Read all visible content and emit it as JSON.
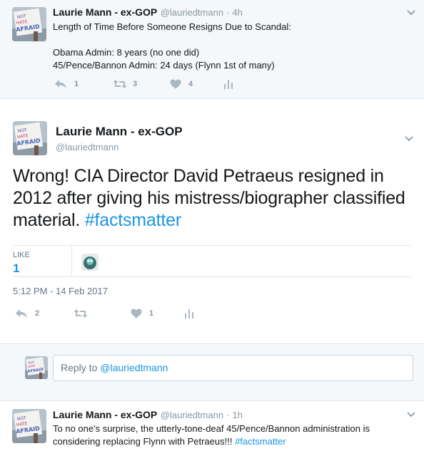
{
  "parent_tweet": {
    "name": "Laurie Mann - ex-GOP",
    "handle": "@lauriedtmann",
    "time": "· 4h",
    "lines": [
      "Length of Time Before Someone Resigns Due to Scandal:",
      "",
      "Obama Admin: 8 years (no one did)",
      "45/Pence/Bannon Admin: 24 days (Flynn 1st of many)"
    ],
    "reply_count": "1",
    "retweet_count": "3",
    "like_count": "4"
  },
  "main_tweet": {
    "name": "Laurie Mann - ex-GOP",
    "handle": "@lauriedtmann",
    "text": "Wrong! CIA Director David Petraeus resigned in 2012 after giving his mistress/biographer classified material.  ",
    "hashtag": "#factsmatter",
    "likes_label": "LIKE",
    "likes_count": "1",
    "timestamp": "5:12 PM - 14 Feb 2017",
    "reply_count": "2",
    "retweet_count": "",
    "like_count": "1"
  },
  "reply_box": {
    "prefix": "Reply to ",
    "mention": "@lauriedtmann"
  },
  "reply_tweet": {
    "name": "Laurie Mann - ex-GOP",
    "handle": "@lauriedtmann",
    "time": "· 1h",
    "text": "To no one's surprise, the utterly-tone-deaf 45/Pence/Bannon administration is considering replacing Flynn with Petraeus!!!  ",
    "hashtag": "#factsmatter"
  },
  "icons": {
    "reply": "reply-icon",
    "retweet": "retweet-icon",
    "like": "heart-icon",
    "analytics": "analytics-icon",
    "more": "chevron-down-icon"
  },
  "colors": {
    "link": "#1b95e0",
    "muted": "#8899a6",
    "background_alt": "#f5f8fa"
  }
}
